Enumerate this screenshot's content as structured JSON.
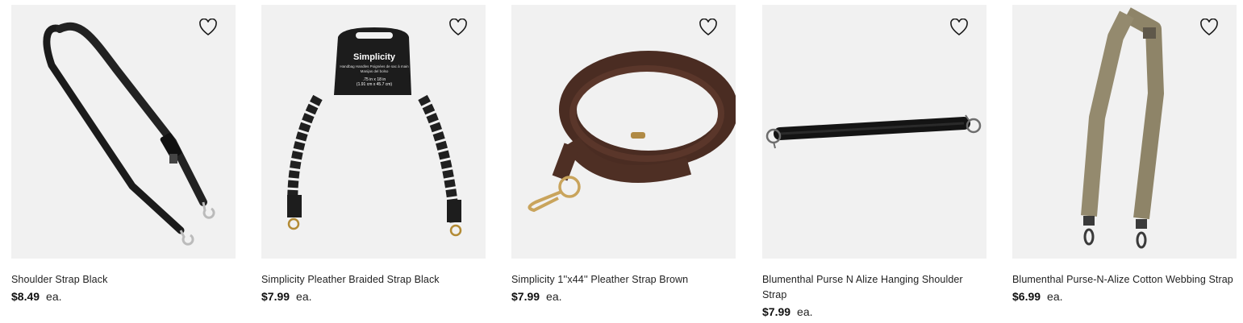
{
  "products": [
    {
      "title": "Shoulder Strap Black",
      "price": "$8.49",
      "unit": "ea.",
      "image_icon": "black-shoulder-strap-image",
      "favorite_icon": "heart-outline-icon"
    },
    {
      "title": "Simplicity Pleather Braided Strap Black",
      "price": "$7.99",
      "unit": "ea.",
      "image_icon": "braided-strap-image",
      "favorite_icon": "heart-outline-icon",
      "package_label": {
        "brand": "Simplicity",
        "line1": "Handbag Handles Poignées de sac à main",
        "line2": "Manijas del bolso",
        "line3": ".75 in x 18 in",
        "line4": "(1.91 cm x 45.7 cm)"
      }
    },
    {
      "title": "Simplicity 1''x44'' Pleather Strap Brown",
      "price": "$7.99",
      "unit": "ea.",
      "image_icon": "brown-coiled-strap-image",
      "favorite_icon": "heart-outline-icon"
    },
    {
      "title": "Blumenthal Purse N Alize Hanging Shoulder Strap",
      "price": "$7.99",
      "unit": "ea.",
      "image_icon": "short-black-strap-image",
      "favorite_icon": "heart-outline-icon"
    },
    {
      "title": "Blumenthal Purse-N-Alize Cotton Webbing Strap",
      "price": "$6.99",
      "unit": "ea.",
      "image_icon": "khaki-webbing-strap-image",
      "favorite_icon": "heart-outline-icon"
    }
  ],
  "colors": {
    "image_bg": "#f1f1f1",
    "text": "#222222",
    "price": "#111111"
  }
}
